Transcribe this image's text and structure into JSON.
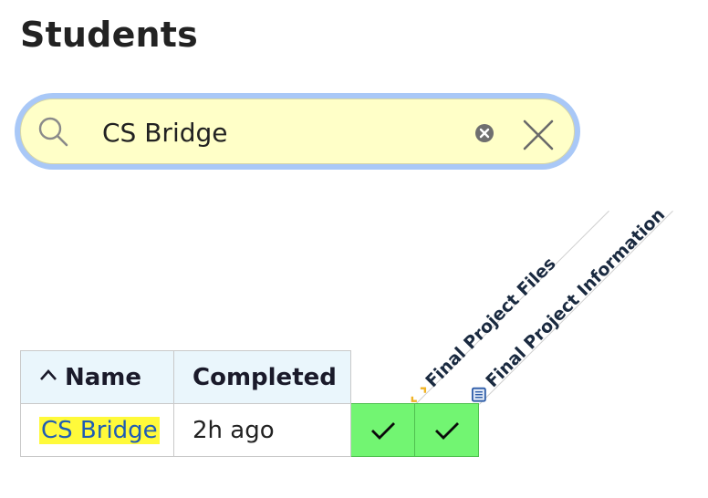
{
  "page": {
    "title": "Students"
  },
  "search": {
    "value": "CS Bridge",
    "icon": "search-icon",
    "clear_icon": "clear-circle-x-icon",
    "close_icon": "close-x-icon"
  },
  "columns": {
    "assignments": [
      {
        "label": "Final Project Files",
        "icon": "expand-corners-icon",
        "icon_color": "#f0b325"
      },
      {
        "label": "Final Project Information",
        "icon": "document-grid-icon",
        "icon_color": "#2d5ca8"
      }
    ],
    "name_header": "Name",
    "completed_header": "Completed",
    "sort_icon": "chevron-up-icon"
  },
  "table": {
    "rows": [
      {
        "name": "CS Bridge",
        "completed": "2h ago",
        "statuses": [
          "complete",
          "complete"
        ]
      }
    ]
  },
  "colors": {
    "search_bg": "#ffffc8",
    "search_focus_ring": "#a9c8f7",
    "header_bg": "#eaf6fc",
    "complete_green": "#72f572",
    "link_blue": "#1f5cb5",
    "highlight_yellow": "#fffa3a"
  }
}
